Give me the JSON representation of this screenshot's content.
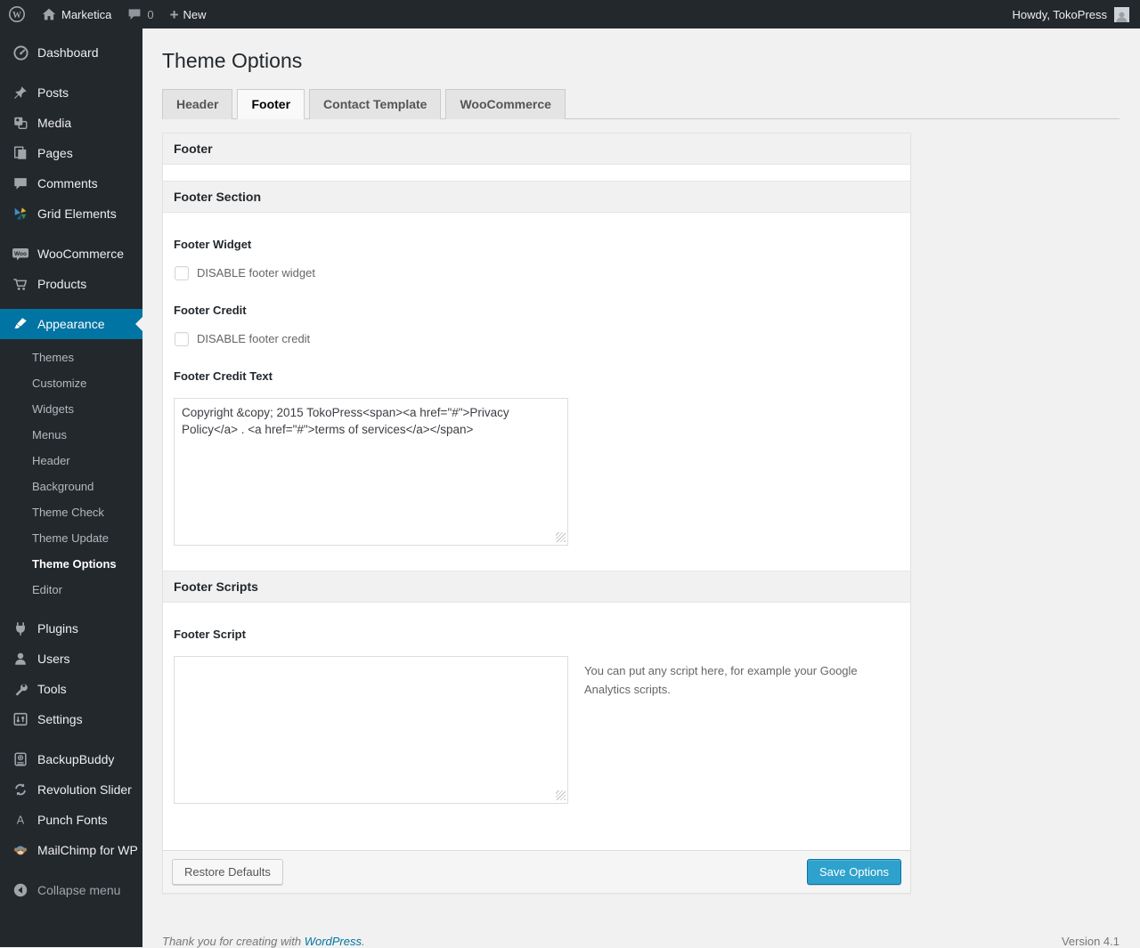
{
  "admin_bar": {
    "site_name": "Marketica",
    "comments_count": "0",
    "new_label": "New",
    "howdy": "Howdy, TokoPress"
  },
  "sidebar": {
    "items": [
      {
        "label": "Dashboard",
        "icon": "dashboard-icon"
      },
      {
        "label": "Posts",
        "icon": "pin-icon"
      },
      {
        "label": "Media",
        "icon": "media-icon"
      },
      {
        "label": "Pages",
        "icon": "pages-icon"
      },
      {
        "label": "Comments",
        "icon": "comment-icon"
      },
      {
        "label": "Grid Elements",
        "icon": "grid-elements-icon"
      },
      {
        "label": "WooCommerce",
        "icon": "woo-badge-icon"
      },
      {
        "label": "Products",
        "icon": "cart-icon"
      },
      {
        "label": "Appearance",
        "icon": "brush-icon",
        "active": true
      },
      {
        "label": "Plugins",
        "icon": "plugin-icon"
      },
      {
        "label": "Users",
        "icon": "user-icon"
      },
      {
        "label": "Tools",
        "icon": "wrench-icon"
      },
      {
        "label": "Settings",
        "icon": "settings-icon"
      },
      {
        "label": "BackupBuddy",
        "icon": "backup-icon"
      },
      {
        "label": "Revolution Slider",
        "icon": "refresh-icon"
      },
      {
        "label": "Punch Fonts",
        "icon": "letter-a-icon"
      },
      {
        "label": "MailChimp for WP",
        "icon": "monkey-icon"
      },
      {
        "label": "Collapse menu",
        "icon": "collapse-icon"
      }
    ],
    "appearance_submenu": [
      {
        "label": "Themes"
      },
      {
        "label": "Customize"
      },
      {
        "label": "Widgets"
      },
      {
        "label": "Menus"
      },
      {
        "label": "Header"
      },
      {
        "label": "Background"
      },
      {
        "label": "Theme Check"
      },
      {
        "label": "Theme Update"
      },
      {
        "label": "Theme Options",
        "current": true
      },
      {
        "label": "Editor"
      }
    ]
  },
  "page": {
    "title": "Theme Options",
    "tabs": [
      {
        "label": "Header",
        "active": false
      },
      {
        "label": "Footer",
        "active": true
      },
      {
        "label": "Contact Template",
        "active": false
      },
      {
        "label": "WooCommerce",
        "active": false
      }
    ],
    "panel": {
      "header": "Footer",
      "section1": {
        "title": "Footer Section",
        "footer_widget_label": "Footer Widget",
        "footer_widget_checkbox": "DISABLE footer widget",
        "footer_widget_checked": false,
        "footer_credit_label": "Footer Credit",
        "footer_credit_checkbox": "DISABLE footer credit",
        "footer_credit_checked": false,
        "footer_credit_text_label": "Footer Credit Text",
        "footer_credit_text_value": "Copyright &copy; 2015 TokoPress<span><a href=\"#\">Privacy Policy</a> . <a href=\"#\">terms of services</a></span>"
      },
      "section2": {
        "title": "Footer Scripts",
        "footer_script_label": "Footer Script",
        "footer_script_value": "",
        "footer_script_description": "You can put any script here, for example your Google Analytics scripts."
      },
      "buttons": {
        "restore": "Restore Defaults",
        "save": "Save Options"
      }
    }
  },
  "footer": {
    "thanks_prefix": "Thank you for creating with ",
    "wordpress_link": "WordPress",
    "thanks_suffix": ".",
    "version": "Version 4.1"
  },
  "colors": {
    "admin_dark": "#23282d",
    "active_blue": "#0074a2",
    "button_primary": "#2ea2cc",
    "content_bg": "#f1f1f1",
    "link_blue": "#0074a2"
  }
}
